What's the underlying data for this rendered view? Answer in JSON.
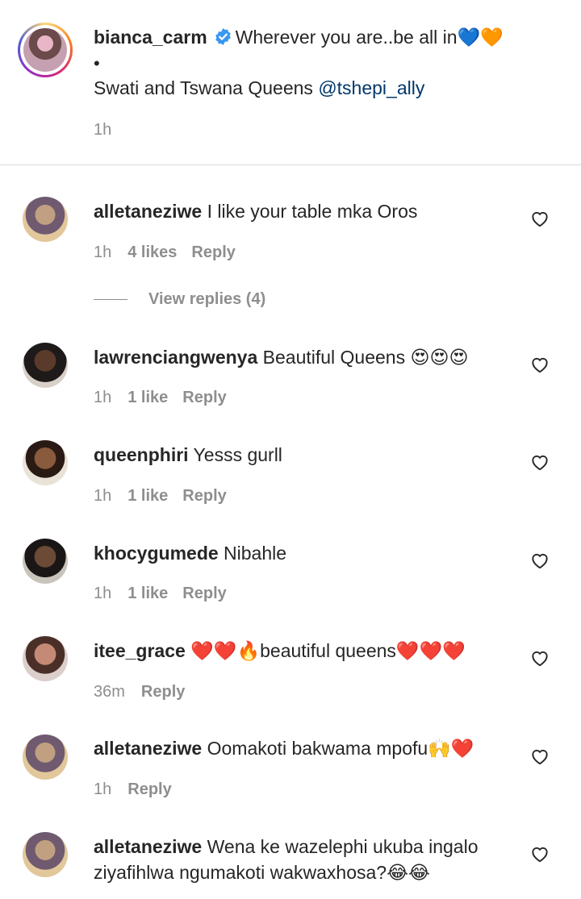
{
  "caption": {
    "username": "bianca_carm",
    "text_line1": "Wherever you are..be all in",
    "emoji_line1": "💙🧡",
    "dot": "•",
    "text_line2": "Swati and Tswana Queens ",
    "mention": "@tshepi_ally",
    "time": "1h"
  },
  "comments": [
    {
      "username": "alletaneziwe",
      "text": "I like your table mka Oros",
      "time": "1h",
      "likes": "4 likes",
      "reply": "Reply"
    },
    {
      "username": "lawrenciangwenya",
      "text": "Beautiful Queens 😍😍😍",
      "time": "1h",
      "likes": "1 like",
      "reply": "Reply"
    },
    {
      "username": "queenphiri",
      "text": "Yesss gurll",
      "time": "1h",
      "likes": "1 like",
      "reply": "Reply"
    },
    {
      "username": "khocygumede",
      "text": "Nibahle",
      "time": "1h",
      "likes": "1 like",
      "reply": "Reply"
    },
    {
      "username": "itee_grace",
      "text": "❤️❤️🔥beautiful queens❤️❤️❤️",
      "time": "36m",
      "reply": "Reply"
    },
    {
      "username": "alletaneziwe",
      "text": "Oomakoti bakwama mpofu🙌❤️",
      "time": "1h",
      "reply": "Reply"
    },
    {
      "username": "alletaneziwe",
      "text": "Wena ke wazelephi ukuba ingalo ziyafihlwa ngumakoti wakwaxhosa?😂😂"
    }
  ],
  "view_replies": "View replies (4)",
  "colors": {
    "text": "#262626",
    "secondary": "#8e8e8e",
    "mention": "#00376b",
    "verified": "#3897f0",
    "divider": "#dbdbdb"
  }
}
